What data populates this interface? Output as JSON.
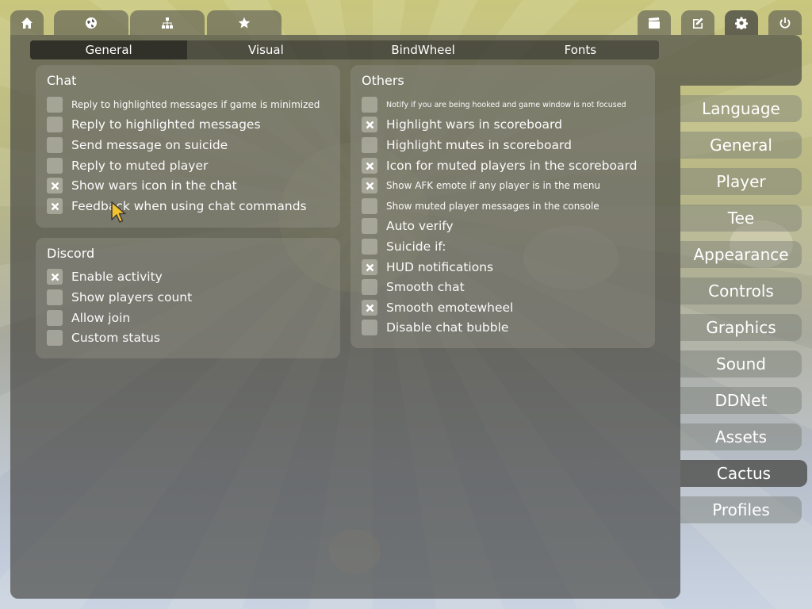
{
  "top_tabs": {
    "left": [
      {
        "icon": "home-icon"
      },
      {
        "icon": "globe-icon"
      },
      {
        "icon": "network-icon"
      },
      {
        "icon": "star-icon"
      }
    ],
    "right": [
      {
        "icon": "clapperboard-icon"
      },
      {
        "icon": "edit-icon"
      },
      {
        "icon": "gear-icon",
        "active": true
      },
      {
        "icon": "power-icon"
      }
    ]
  },
  "subtabs": [
    "General",
    "Visual",
    "BindWheel",
    "Fonts"
  ],
  "subtab_active": "General",
  "chat": {
    "title": "Chat",
    "options": [
      {
        "label": "Reply to highlighted messages if game is minimized",
        "checked": false
      },
      {
        "label": "Reply to highlighted messages",
        "checked": false
      },
      {
        "label": "Send message on suicide",
        "checked": false
      },
      {
        "label": "Reply to muted player",
        "checked": false
      },
      {
        "label": "Show wars icon in the chat",
        "checked": true
      },
      {
        "label": "Feedback when using chat commands",
        "checked": true
      }
    ]
  },
  "discord": {
    "title": "Discord",
    "options": [
      {
        "label": "Enable activity",
        "checked": true
      },
      {
        "label": "Show players count",
        "checked": false
      },
      {
        "label": "Allow join",
        "checked": false
      },
      {
        "label": "Custom status",
        "checked": false
      }
    ]
  },
  "others": {
    "title": "Others",
    "options": [
      {
        "label": "Notify if you are being hooked and game window is not focused",
        "checked": false
      },
      {
        "label": "Highlight wars in scoreboard",
        "checked": true
      },
      {
        "label": "Highlight mutes in scoreboard",
        "checked": false
      },
      {
        "label": "Icon for muted players in the scoreboard",
        "checked": true
      },
      {
        "label": "Show AFK emote if any player is in the menu",
        "checked": true
      },
      {
        "label": "Show muted player messages in the console",
        "checked": false
      },
      {
        "label": "Auto verify",
        "checked": false
      },
      {
        "label": "Suicide if:",
        "checked": false
      },
      {
        "label": "HUD notifications",
        "checked": true
      },
      {
        "label": "Smooth chat",
        "checked": false
      },
      {
        "label": "Smooth emotewheel",
        "checked": true
      },
      {
        "label": "Disable chat bubble",
        "checked": false
      }
    ]
  },
  "settings_menu": {
    "items": [
      "Language",
      "General",
      "Player",
      "Tee",
      "Appearance",
      "Controls",
      "Graphics",
      "Sound",
      "DDNet",
      "Assets",
      "Cactus",
      "Profiles"
    ],
    "active": "Cactus"
  }
}
